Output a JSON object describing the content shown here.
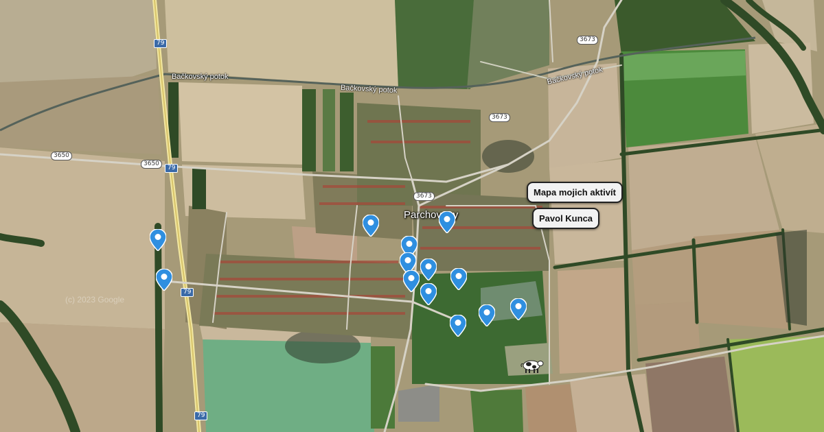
{
  "map": {
    "town_name": "Parchovany",
    "stream_label": "Bačkovský potok",
    "watermark": "(c) 2023 Google",
    "road_shields": {
      "r79": "79",
      "r3650": "3650",
      "r3673": "3673"
    }
  },
  "buttons": {
    "activities": "Mapa mojich aktivít",
    "author": "Pavol Kunca"
  },
  "markers": {
    "color": "#2f8fe0",
    "icon": "map-pin-icon",
    "count": 13
  },
  "mascot": {
    "icon": "cow-icon"
  }
}
